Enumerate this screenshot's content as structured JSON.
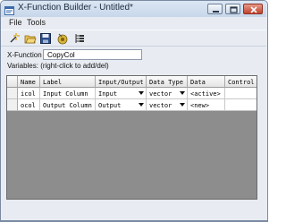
{
  "window": {
    "title": "X-Function Builder - Untitled*"
  },
  "menu": {
    "items": [
      "File",
      "Tools"
    ]
  },
  "toolbar": {
    "tools": [
      "new-icon",
      "open-folder-icon",
      "save-icon",
      "compile-icon",
      "tree-view-icon"
    ]
  },
  "form": {
    "name_label": "X-Function",
    "name_value": "CopyCol",
    "variables_label": "Variables: (right-click to add/del)"
  },
  "grid": {
    "headers": [
      "Name",
      "Label",
      "Input/Output",
      "Data Type",
      "Data",
      "Control"
    ],
    "rows": [
      {
        "name": "icol",
        "label": "Input Column",
        "io": "Input",
        "type": "vector",
        "data": "<active>",
        "control": ""
      },
      {
        "name": "ocol",
        "label": "Output Column",
        "io": "Output",
        "type": "vector",
        "data": "<new>",
        "control": ""
      }
    ]
  },
  "colors": {
    "grid_background": "#8d8d8d",
    "titlebar": "#c7d7ea",
    "close_button": "#c0432c"
  }
}
